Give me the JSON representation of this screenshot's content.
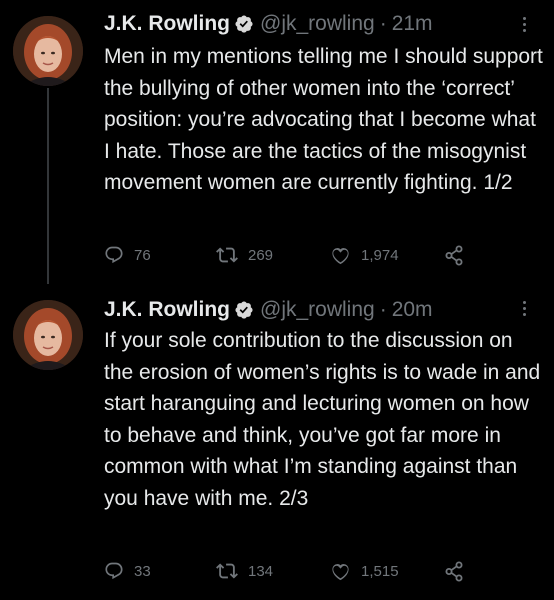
{
  "colors": {
    "background": "#000000",
    "text": "#e7e9ea",
    "muted": "#71767b",
    "verified": "#d9d9d9",
    "thread_line": "#333639"
  },
  "icons": {
    "verified": "verified-badge-icon",
    "more": "more-options-icon",
    "reply": "reply-icon",
    "retweet": "retweet-icon",
    "like": "heart-icon",
    "share": "share-icon"
  },
  "tweets": [
    {
      "display_name": "J.K. Rowling",
      "handle": "@jk_rowling",
      "separator": "·",
      "time": "21m",
      "text": "Men in my mentions telling me I should support the bullying of other women into the ‘correct’ position: you’re advocating that I become what I hate.  Those are the tactics of the misogynist movement women are currently fighting. 1/2",
      "replies": "76",
      "retweets": "269",
      "likes": "1,974"
    },
    {
      "display_name": "J.K. Rowling",
      "handle": "@jk_rowling",
      "separator": "·",
      "time": "20m",
      "text": "If your sole contribution to the discussion on the erosion of women’s rights is to wade in and start haranguing and lecturing women on how to behave and think, you’ve got far more in common with what I’m standing against than you have with me. 2/3",
      "replies": "33",
      "retweets": "134",
      "likes": "1,515"
    }
  ]
}
